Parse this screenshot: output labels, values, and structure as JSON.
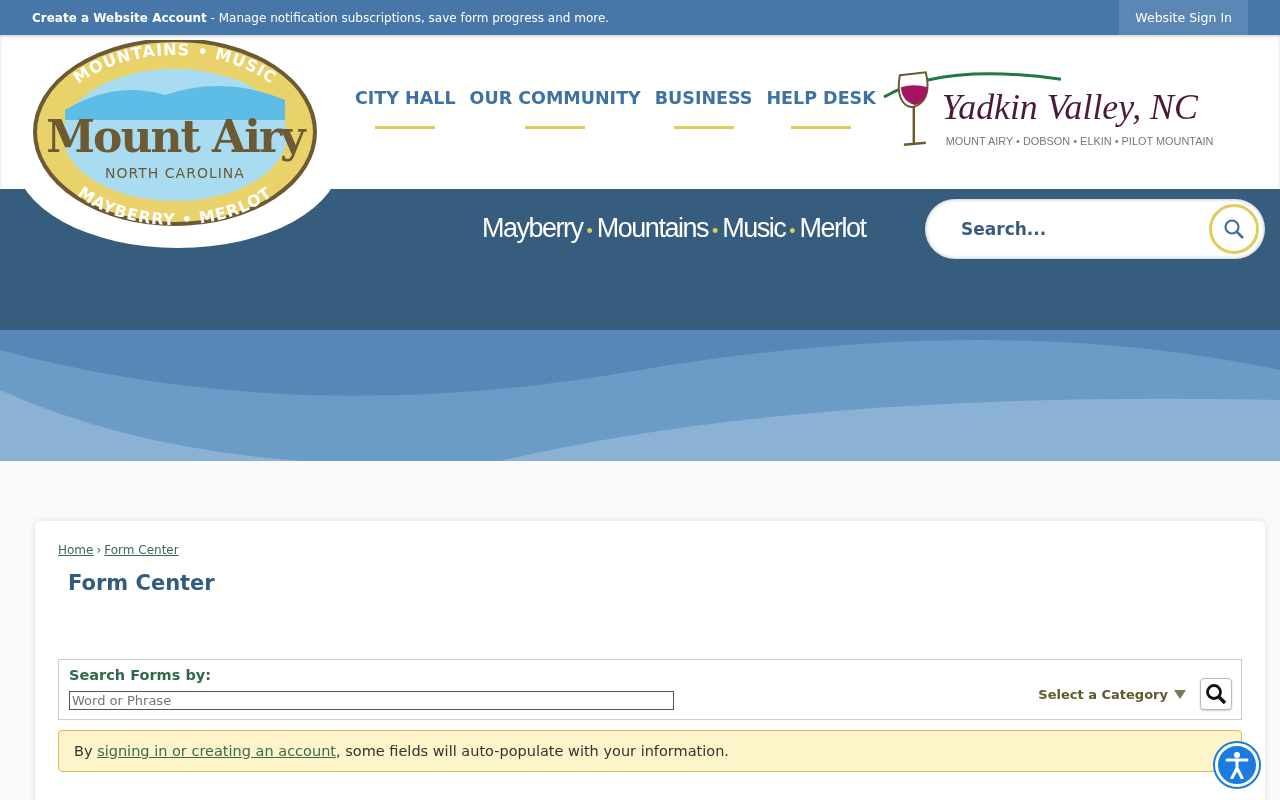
{
  "top_bar": {
    "account_link": "Create a Website Account",
    "account_text": " - Manage notification subscriptions, save form progress and more.",
    "sign_in": "Website Sign In"
  },
  "logo": {
    "top_arc": "MOUNTAINS • MUSIC",
    "name": "Mount Airy",
    "state": "NORTH CAROLINA",
    "bottom_arc": "MAYBERRY • MERLOT"
  },
  "nav": [
    "CITY HALL",
    "OUR COMMUNITY",
    "BUSINESS",
    "HELP DESK"
  ],
  "partner_logo": {
    "title": "Yadkin Valley, NC",
    "towns": "MOUNT AIRY • DOBSON • ELKIN • PILOT MOUNTAIN"
  },
  "tagline": {
    "words": [
      "Mayberry",
      "Mountains",
      "Music",
      "Merlot"
    ],
    "separator": "•"
  },
  "site_search": {
    "placeholder": "Search..."
  },
  "breadcrumb": [
    {
      "label": "Home"
    },
    {
      "label": "Form Center"
    }
  ],
  "breadcrumb_separator": "›",
  "page_title": "Form Center",
  "search_forms": {
    "label": "Search Forms by:",
    "placeholder": "Word or Phrase",
    "category": "Select a Category"
  },
  "notice": {
    "before": "By ",
    "link": "signing in or creating an account",
    "after": ", some fields will auto-populate with your information."
  }
}
